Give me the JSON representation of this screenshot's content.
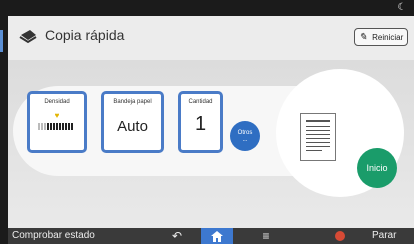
{
  "header": {
    "title": "Copia rápida",
    "reset_label": "Reiniciar"
  },
  "settings": {
    "density": {
      "label": "Densidad"
    },
    "tray": {
      "label": "Bandeja papel",
      "value": "Auto"
    },
    "quantity": {
      "label": "Cantidad",
      "value": "1"
    },
    "other": {
      "label": "Otros",
      "dots": "..."
    }
  },
  "actions": {
    "start_label": "Inicio"
  },
  "status_bar": {
    "status_label": "Comprobar estado",
    "stop_label": "Parar"
  },
  "colors": {
    "accent_blue": "#4a7bc7",
    "start_green": "#1a9c6a",
    "stop_red": "#d64a35"
  },
  "icons": [
    "moon-icon",
    "copy-app-icon",
    "pen-icon",
    "density-level-icon",
    "back-icon",
    "home-icon",
    "menu-icon",
    "stop-icon"
  ]
}
